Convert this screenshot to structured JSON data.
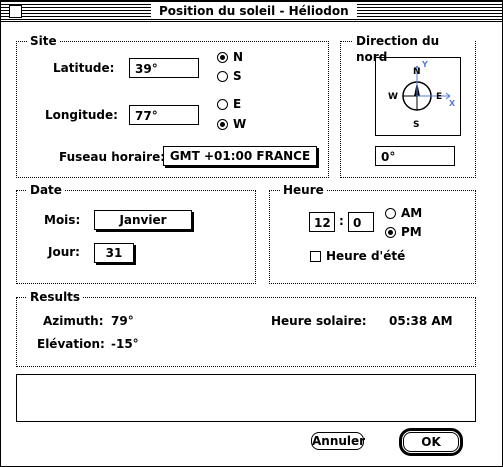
{
  "window": {
    "title": "Position du soleil - Héliodon"
  },
  "site": {
    "legend": "Site",
    "latitude_label": "Latitude:",
    "latitude_value": "39°",
    "lat_n": "N",
    "lat_s": "S",
    "lat_selected": "N",
    "longitude_label": "Longitude:",
    "longitude_value": "77°",
    "lon_e": "E",
    "lon_w": "W",
    "lon_selected": "W",
    "timezone_label": "Fuseau horaire:",
    "timezone_value": "GMT +01:00  FRANCE"
  },
  "north": {
    "legend": "Direction du nord",
    "value": "0°",
    "compass": {
      "n": "N",
      "s": "S",
      "e": "E",
      "w": "W",
      "x": "X",
      "y": "Y"
    }
  },
  "date": {
    "legend": "Date",
    "month_label": "Mois:",
    "month_value": "Janvier",
    "day_label": "Jour:",
    "day_value": "31"
  },
  "time": {
    "legend": "Heure",
    "hour": "12",
    "separator": ":",
    "minute": "0",
    "am": "AM",
    "pm": "PM",
    "ampm_selected": "PM",
    "dst_label": "Heure d'été",
    "dst_checked": false
  },
  "results": {
    "legend": "Results",
    "azimuth_label": "Azimuth:",
    "azimuth_value": "79°",
    "elevation_label": "Elévation:",
    "elevation_value": "-15°",
    "solar_time_label": "Heure solaire:",
    "solar_time_value": "05:38  AM"
  },
  "buttons": {
    "cancel": "Annuler",
    "ok": "OK"
  }
}
